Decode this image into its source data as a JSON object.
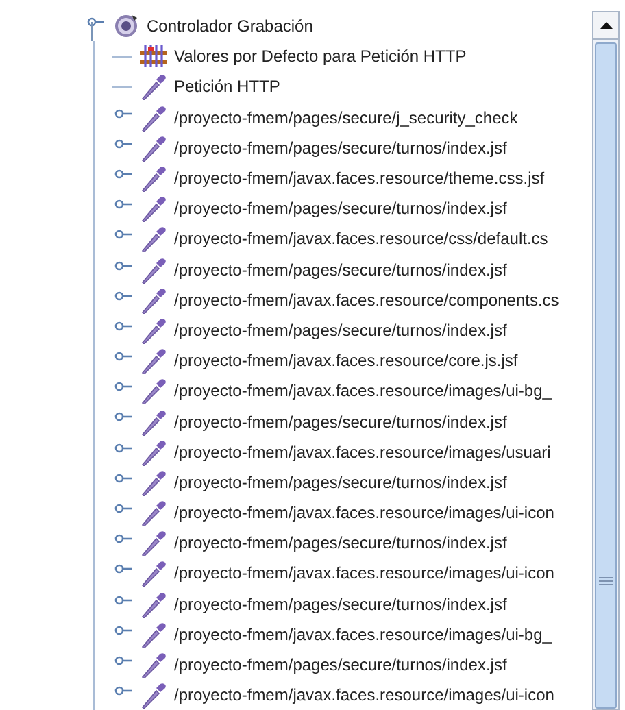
{
  "tree": {
    "label": "Controlador Grabación",
    "kind": "controller",
    "expanded": true,
    "children": [
      {
        "label": "Valores por Defecto para Petición HTTP",
        "kind": "config"
      },
      {
        "label": "Petición HTTP",
        "kind": "sampler"
      },
      {
        "label": "/proyecto-fmem/pages/secure/j_security_check",
        "kind": "sampler",
        "expanded": false
      },
      {
        "label": "/proyecto-fmem/pages/secure/turnos/index.jsf",
        "kind": "sampler",
        "expanded": false
      },
      {
        "label": "/proyecto-fmem/javax.faces.resource/theme.css.jsf",
        "kind": "sampler",
        "expanded": false
      },
      {
        "label": "/proyecto-fmem/pages/secure/turnos/index.jsf",
        "kind": "sampler",
        "expanded": false
      },
      {
        "label": "/proyecto-fmem/javax.faces.resource/css/default.cs",
        "kind": "sampler",
        "expanded": false
      },
      {
        "label": "/proyecto-fmem/pages/secure/turnos/index.jsf",
        "kind": "sampler",
        "expanded": false
      },
      {
        "label": "/proyecto-fmem/javax.faces.resource/components.cs",
        "kind": "sampler",
        "expanded": false
      },
      {
        "label": "/proyecto-fmem/pages/secure/turnos/index.jsf",
        "kind": "sampler",
        "expanded": false
      },
      {
        "label": "/proyecto-fmem/javax.faces.resource/core.js.jsf",
        "kind": "sampler",
        "expanded": false
      },
      {
        "label": "/proyecto-fmem/javax.faces.resource/images/ui-bg_",
        "kind": "sampler",
        "expanded": false
      },
      {
        "label": "/proyecto-fmem/pages/secure/turnos/index.jsf",
        "kind": "sampler",
        "expanded": false
      },
      {
        "label": "/proyecto-fmem/javax.faces.resource/images/usuari",
        "kind": "sampler",
        "expanded": false
      },
      {
        "label": "/proyecto-fmem/pages/secure/turnos/index.jsf",
        "kind": "sampler",
        "expanded": false
      },
      {
        "label": "/proyecto-fmem/javax.faces.resource/images/ui-icon",
        "kind": "sampler",
        "expanded": false
      },
      {
        "label": "/proyecto-fmem/pages/secure/turnos/index.jsf",
        "kind": "sampler",
        "expanded": false
      },
      {
        "label": "/proyecto-fmem/javax.faces.resource/images/ui-icon",
        "kind": "sampler",
        "expanded": false
      },
      {
        "label": "/proyecto-fmem/pages/secure/turnos/index.jsf",
        "kind": "sampler",
        "expanded": false
      },
      {
        "label": "/proyecto-fmem/javax.faces.resource/images/ui-bg_",
        "kind": "sampler",
        "expanded": false
      },
      {
        "label": "/proyecto-fmem/pages/secure/turnos/index.jsf",
        "kind": "sampler",
        "expanded": false
      },
      {
        "label": "/proyecto-fmem/javax.faces.resource/images/ui-icon",
        "kind": "sampler",
        "expanded": false
      }
    ]
  }
}
